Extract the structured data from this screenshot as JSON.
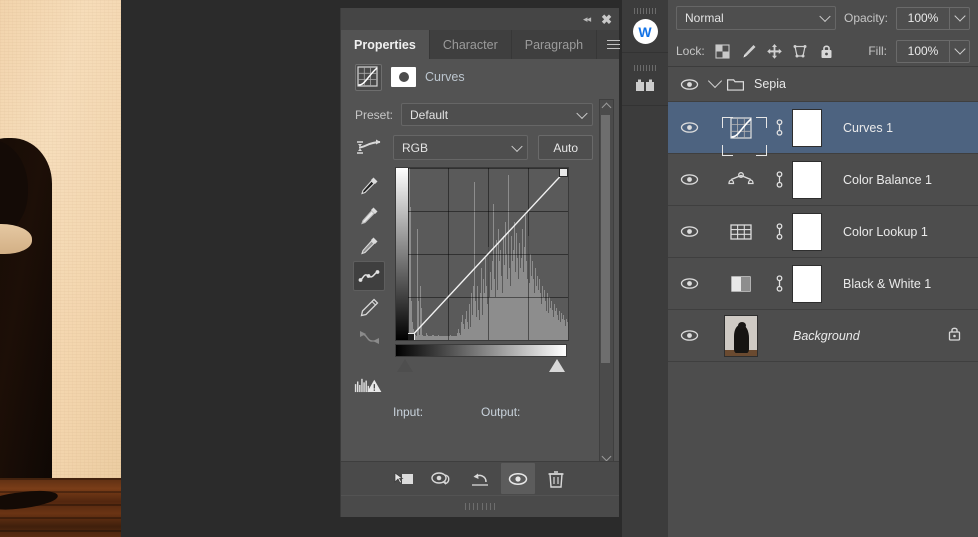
{
  "properties_panel": {
    "header": {
      "collapse_icon": "double-chevron-left-icon",
      "close_icon": "close-icon",
      "menu_icon": "panel-menu-icon"
    },
    "tabs": [
      {
        "label": "Properties",
        "active": true
      },
      {
        "label": "Character",
        "active": false
      },
      {
        "label": "Paragraph",
        "active": false
      }
    ],
    "adjustment": {
      "icon": "curves-adjustment-icon",
      "mask_icon": "layer-mask-thumbnail",
      "title": "Curves"
    },
    "preset": {
      "label": "Preset:",
      "value": "Default",
      "dropdown_icon": "chevron-down-icon"
    },
    "channel": {
      "preset_icon": "curve-preset-icon",
      "value": "RGB",
      "dropdown_icon": "chevron-down-icon",
      "auto_button": "Auto"
    },
    "tools": [
      {
        "name": "sample-in-image-eyedropper-icon",
        "active": false,
        "dim": false
      },
      {
        "name": "black-point-eyedropper-icon",
        "active": false,
        "dim": false
      },
      {
        "name": "gray-point-eyedropper-icon",
        "active": false,
        "dim": false
      },
      {
        "name": "curve-point-tool-icon",
        "active": true,
        "dim": false
      },
      {
        "name": "pencil-draw-curve-icon",
        "active": false,
        "dim": false
      },
      {
        "name": "smooth-curve-icon",
        "active": false,
        "dim": true
      },
      {
        "name": "histogram-warning-icon",
        "active": false,
        "dim": false
      }
    ],
    "graph": {
      "input_label": "Input:",
      "output_label": "Output:",
      "input_value": "",
      "output_value": "",
      "grid_columns": 4,
      "grid_rows": 4
    },
    "scrollbar": {
      "up_icon": "chevron-up-icon",
      "down_icon": "chevron-down-icon"
    },
    "footer_buttons": [
      {
        "name": "clip-to-layer-icon",
        "active": false
      },
      {
        "name": "toggle-previous-state-icon",
        "active": false
      },
      {
        "name": "reset-adjustment-icon",
        "active": false
      },
      {
        "name": "toggle-layer-visibility-icon",
        "active": true
      },
      {
        "name": "delete-adjustment-layer-icon",
        "active": false
      }
    ]
  },
  "mini_dock": {
    "items": [
      {
        "name": "dock-item-wacom",
        "glyph": "W"
      },
      {
        "name": "dock-item-libraries",
        "glyph": ""
      }
    ]
  },
  "layers_panel": {
    "blend_mode": {
      "value": "Normal",
      "dropdown_icon": "chevron-down-icon"
    },
    "opacity": {
      "label": "Opacity:",
      "value": "100%",
      "dropdown_icon": "chevron-down-icon"
    },
    "fill": {
      "label": "Fill:",
      "value": "100%",
      "dropdown_icon": "chevron-down-icon"
    },
    "lock": {
      "label": "Lock:",
      "icons": [
        "lock-transparent-pixels-icon",
        "lock-image-pixels-icon",
        "lock-position-icon",
        "lock-artboard-nesting-icon",
        "lock-all-icon"
      ]
    },
    "group": {
      "name": "Sepia",
      "visible": true,
      "expanded": true,
      "eye_icon": "eye-icon",
      "folder_icon": "folder-icon",
      "chevron_icon": "chevron-down-icon"
    },
    "layers": [
      {
        "name": "Curves 1",
        "type": "adjustment",
        "icon": "curves-layer-icon",
        "selected": true,
        "visible": true,
        "linked": true,
        "has_mask": true,
        "locked": false,
        "italic": false
      },
      {
        "name": "Color Balance 1",
        "type": "adjustment",
        "icon": "color-balance-layer-icon",
        "selected": false,
        "visible": true,
        "linked": true,
        "has_mask": true,
        "locked": false,
        "italic": false
      },
      {
        "name": "Color Lookup 1",
        "type": "adjustment",
        "icon": "color-lookup-layer-icon",
        "selected": false,
        "visible": true,
        "linked": true,
        "has_mask": true,
        "locked": false,
        "italic": false
      },
      {
        "name": "Black & White 1",
        "type": "adjustment",
        "icon": "black-and-white-layer-icon",
        "selected": false,
        "visible": true,
        "linked": true,
        "has_mask": true,
        "locked": false,
        "italic": false
      },
      {
        "name": "Background",
        "type": "image",
        "icon": "background-photo-thumbnail",
        "selected": false,
        "visible": true,
        "linked": false,
        "has_mask": false,
        "locked": true,
        "italic": true
      }
    ]
  },
  "colors": {
    "panel_bg": "#535353",
    "layers_bg": "#4d4d4d",
    "selection_blue": "#4d6380",
    "workspace_bg": "#2b2b2b",
    "accent_blue": "#1473e6",
    "text_primary": "#eaeaea"
  },
  "chart_data": {
    "type": "line",
    "title": "Curves",
    "xlabel": "Input",
    "ylabel": "Output",
    "xlim": [
      0,
      255
    ],
    "ylim": [
      0,
      255
    ],
    "grid": true,
    "series": [
      {
        "name": "RGB curve",
        "points": [
          [
            0,
            0
          ],
          [
            255,
            255
          ]
        ]
      }
    ],
    "histogram": [
      4,
      96,
      30,
      74,
      22,
      10,
      6,
      4,
      3,
      3,
      2,
      62,
      22,
      4,
      3,
      30,
      18,
      3,
      2,
      2,
      2,
      2,
      3,
      4,
      3,
      2,
      2,
      2,
      2,
      2,
      3,
      3,
      2,
      2,
      2,
      2,
      2,
      2,
      3,
      2,
      2,
      2,
      2,
      2,
      2,
      2,
      2,
      2,
      2,
      2,
      2,
      2,
      2,
      3,
      2,
      2,
      2,
      2,
      2,
      2,
      2,
      3,
      4,
      6,
      4,
      3,
      6,
      10,
      14,
      9,
      6,
      12,
      8,
      16,
      10,
      6,
      20,
      12,
      7,
      26,
      14,
      9,
      30,
      88,
      22,
      13,
      18,
      30,
      17,
      11,
      26,
      40,
      20,
      14,
      34,
      26,
      18,
      46,
      30,
      20,
      52,
      34,
      24,
      38,
      28,
      20,
      44,
      76,
      34,
      24,
      56,
      40,
      28,
      62,
      44,
      30,
      50,
      36,
      26,
      58,
      42,
      30,
      66,
      48,
      34,
      72,
      92,
      40,
      30,
      58,
      44,
      32,
      50,
      66,
      38,
      28,
      60,
      46,
      34,
      54,
      40,
      30,
      46,
      62,
      38,
      30,
      52,
      70,
      44,
      34,
      58,
      42,
      32,
      48,
      36,
      28,
      44,
      34,
      26,
      40,
      30,
      24,
      36,
      28,
      22,
      34,
      26,
      20,
      30,
      24,
      18,
      28,
      22,
      16,
      26,
      20,
      15,
      24,
      18,
      14,
      22,
      17,
      13,
      20,
      16,
      12,
      18,
      14,
      11,
      16,
      13,
      10,
      15,
      12,
      9,
      14,
      11,
      8,
      12,
      10
    ],
    "control_points": [
      {
        "input": 0,
        "output": 0,
        "style": "filled"
      },
      {
        "input": 255,
        "output": 255,
        "style": "open"
      }
    ]
  }
}
